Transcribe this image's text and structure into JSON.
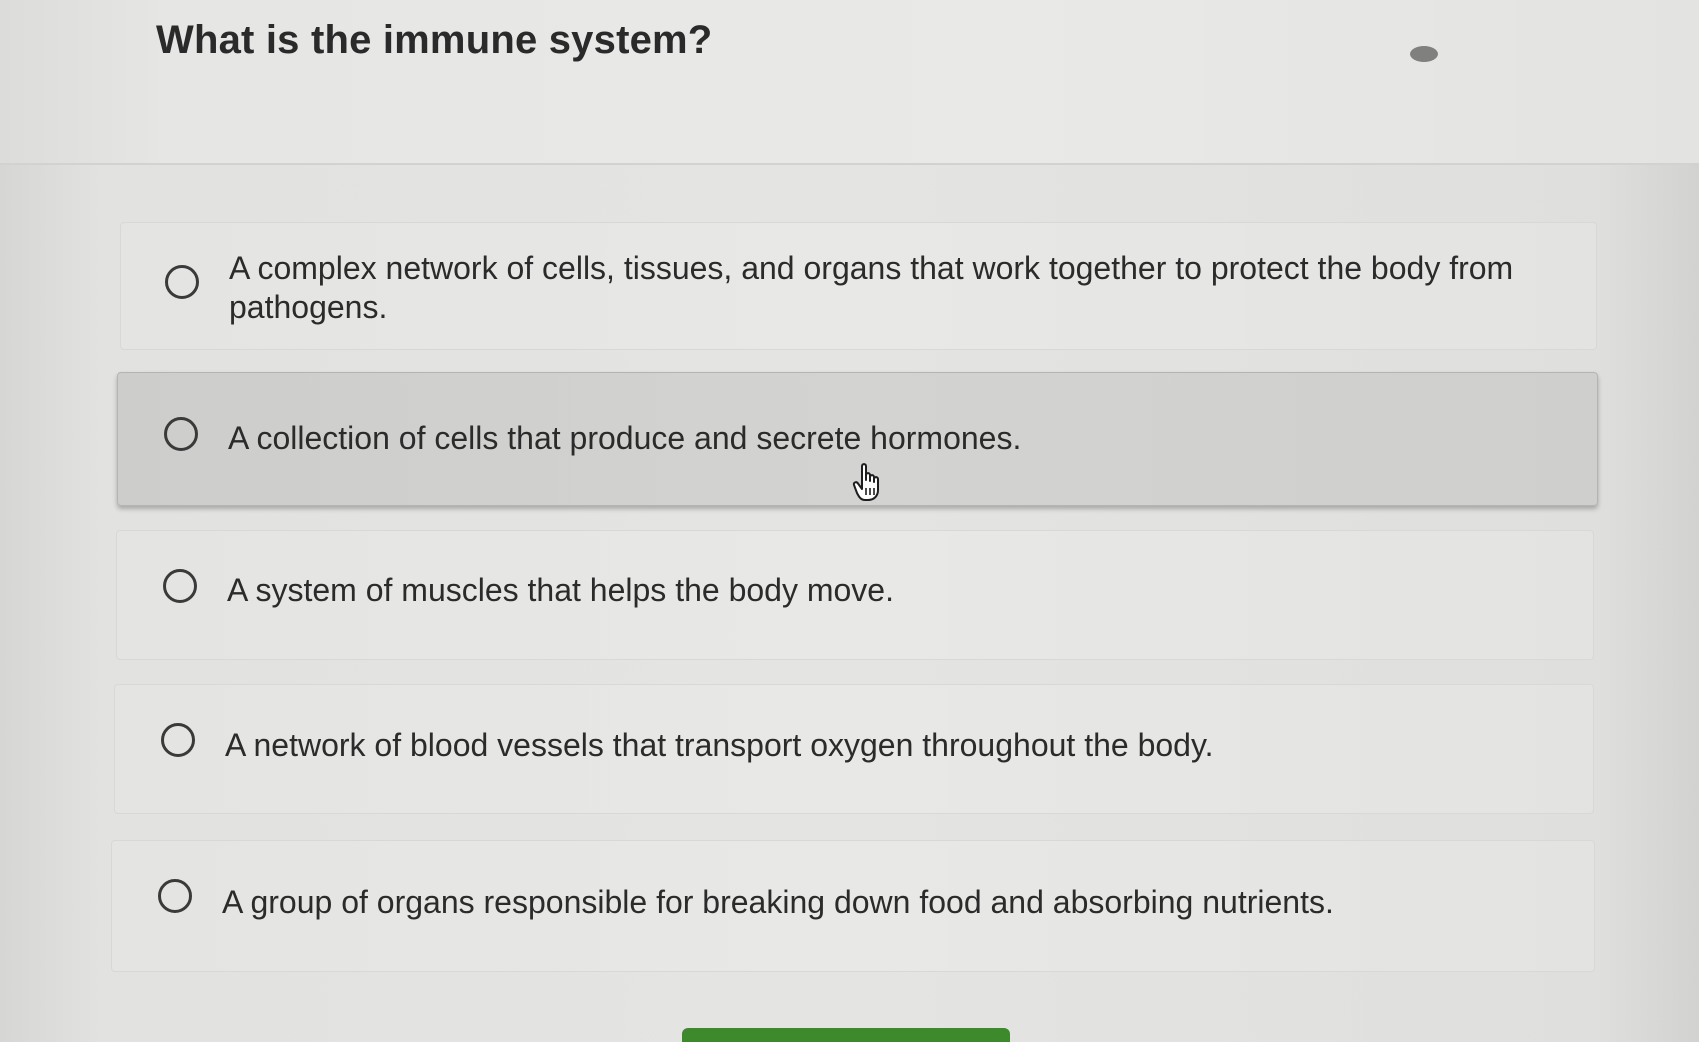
{
  "question": {
    "text": "What is the immune system?"
  },
  "options": [
    {
      "label": "A complex network of cells, tissues, and organs that work together to protect the body from pathogens.",
      "selected": false
    },
    {
      "label": "A collection of cells that produce and secrete hormones.",
      "selected": false,
      "hovered": true
    },
    {
      "label": "A system of muscles that helps the body move.",
      "selected": false
    },
    {
      "label": "A network of blood vessels that transport oxygen throughout the body.",
      "selected": false
    },
    {
      "label": "A group of organs responsible for breaking down food and absorbing nutrients.",
      "selected": false
    }
  ],
  "icons": {
    "cursor": "hand-pointer-icon",
    "radio": "radio-unchecked-icon"
  },
  "colors": {
    "submit_button": "#3c8a2c",
    "text": "#2b2b2b",
    "hover_background": "#d1d1cf"
  }
}
